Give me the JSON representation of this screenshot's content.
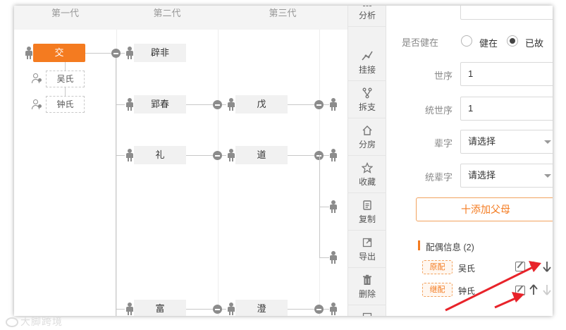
{
  "tree": {
    "headers": [
      "第一代",
      "第二代",
      "第三代"
    ],
    "gen1": {
      "person": "交",
      "spouses": [
        "吴氏",
        "钟氏"
      ]
    },
    "gen2": [
      "辟非",
      "郢春",
      "礼",
      "富"
    ],
    "gen3": [
      "戊",
      "道",
      "澄"
    ]
  },
  "toolbar": {
    "items": [
      {
        "label": "分析",
        "icon": "bar-chart-icon"
      },
      {
        "label": "挂接",
        "icon": "link-line-icon"
      },
      {
        "label": "拆支",
        "icon": "branch-icon"
      },
      {
        "label": "分房",
        "icon": "house-icon"
      },
      {
        "label": "收藏",
        "icon": "star-icon"
      },
      {
        "label": "复制",
        "icon": "copy-icon"
      },
      {
        "label": "导出",
        "icon": "export-icon"
      },
      {
        "label": "删除",
        "icon": "trash-icon"
      }
    ]
  },
  "panel": {
    "alive_label": "是否健在",
    "alive_options": [
      "健在",
      "已故"
    ],
    "alive_selected": "已故",
    "generation_label": "世序",
    "generation_value": "1",
    "unified_generation_label": "统世序",
    "unified_generation_value": "1",
    "bei_label": "辈字",
    "bei_placeholder": "请选择",
    "unified_bei_label": "统辈字",
    "unified_bei_placeholder": "请选择",
    "add_parent": "十添加父母",
    "spouse_section_title": "配偶信息 (2)",
    "spouses": [
      {
        "tag": "原配",
        "name": "吴氏"
      },
      {
        "tag": "继配",
        "name": "钟氏"
      }
    ]
  },
  "colors": {
    "accent": "#f47b20",
    "annotation_arrow": "#e8232a"
  },
  "watermark": "大脚跨境"
}
